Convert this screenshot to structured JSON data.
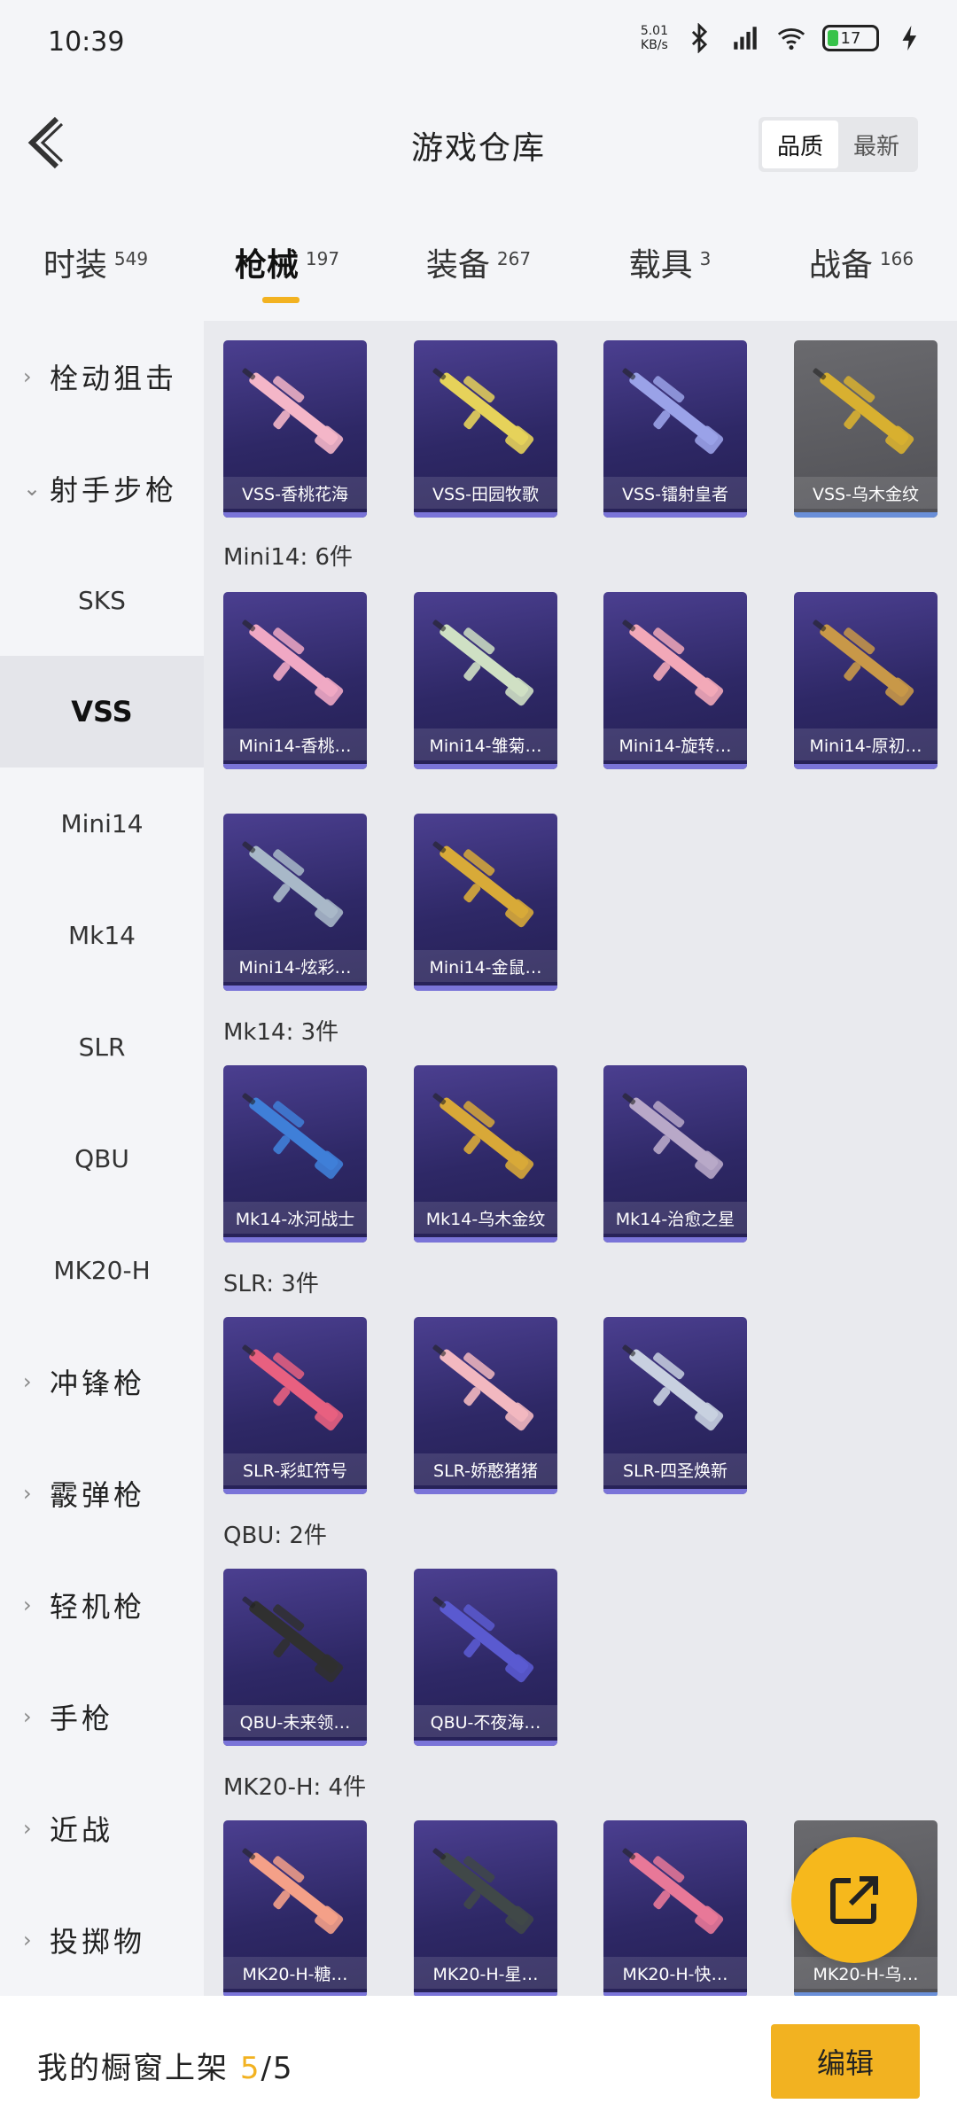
{
  "status": {
    "time": "10:39",
    "speed_value": "5.01",
    "speed_unit": "KB/s",
    "battery": "17"
  },
  "header": {
    "title": "游戏仓库",
    "sort_quality": "品质",
    "sort_latest": "最新"
  },
  "tabs": [
    {
      "label": "时装",
      "count": "549"
    },
    {
      "label": "枪械",
      "count": "197"
    },
    {
      "label": "装备",
      "count": "267"
    },
    {
      "label": "载具",
      "count": "3"
    },
    {
      "label": "战备",
      "count": "166"
    }
  ],
  "sidebar": [
    {
      "label": "栓动狙击",
      "chev": "›"
    },
    {
      "label": "射手步枪",
      "chev": "⌄"
    },
    {
      "label": "SKS"
    },
    {
      "label": "VSS"
    },
    {
      "label": "Mini14"
    },
    {
      "label": "Mk14"
    },
    {
      "label": "SLR"
    },
    {
      "label": "QBU"
    },
    {
      "label": "MK20-H"
    },
    {
      "label": "冲锋枪",
      "chev": "›"
    },
    {
      "label": "霰弹枪",
      "chev": "›"
    },
    {
      "label": "轻机枪",
      "chev": "›"
    },
    {
      "label": "手枪",
      "chev": "›"
    },
    {
      "label": "近战",
      "chev": "›"
    },
    {
      "label": "投掷物",
      "chev": "›"
    }
  ],
  "sections": {
    "vss": {
      "items": [
        "VSS-香桃花海",
        "VSS-田园牧歌",
        "VSS-镭射皇者",
        "VSS-乌木金纹"
      ]
    },
    "mini14": {
      "title": "Mini14: 6件",
      "items": [
        "Mini14-香桃…",
        "Mini14-雏菊…",
        "Mini14-旋转…",
        "Mini14-原初…",
        "Mini14-炫彩…",
        "Mini14-金鼠…"
      ]
    },
    "mk14": {
      "title": "Mk14: 3件",
      "items": [
        "Mk14-冰河战士",
        "Mk14-乌木金纹",
        "Mk14-治愈之星"
      ]
    },
    "slr": {
      "title": "SLR: 3件",
      "items": [
        "SLR-彩虹符号",
        "SLR-娇憨猪猪",
        "SLR-四圣焕新"
      ]
    },
    "qbu": {
      "title": "QBU: 2件",
      "items": [
        "QBU-未来领…",
        "QBU-不夜海…"
      ]
    },
    "mk20": {
      "title": "MK20-H: 4件",
      "items": [
        "MK20-H-糖…",
        "MK20-H-星…",
        "MK20-H-快…",
        "MK20-H-乌…"
      ]
    }
  },
  "bottom": {
    "label": "我的橱窗上架",
    "current": "5",
    "total": "/5",
    "edit": "编辑"
  }
}
